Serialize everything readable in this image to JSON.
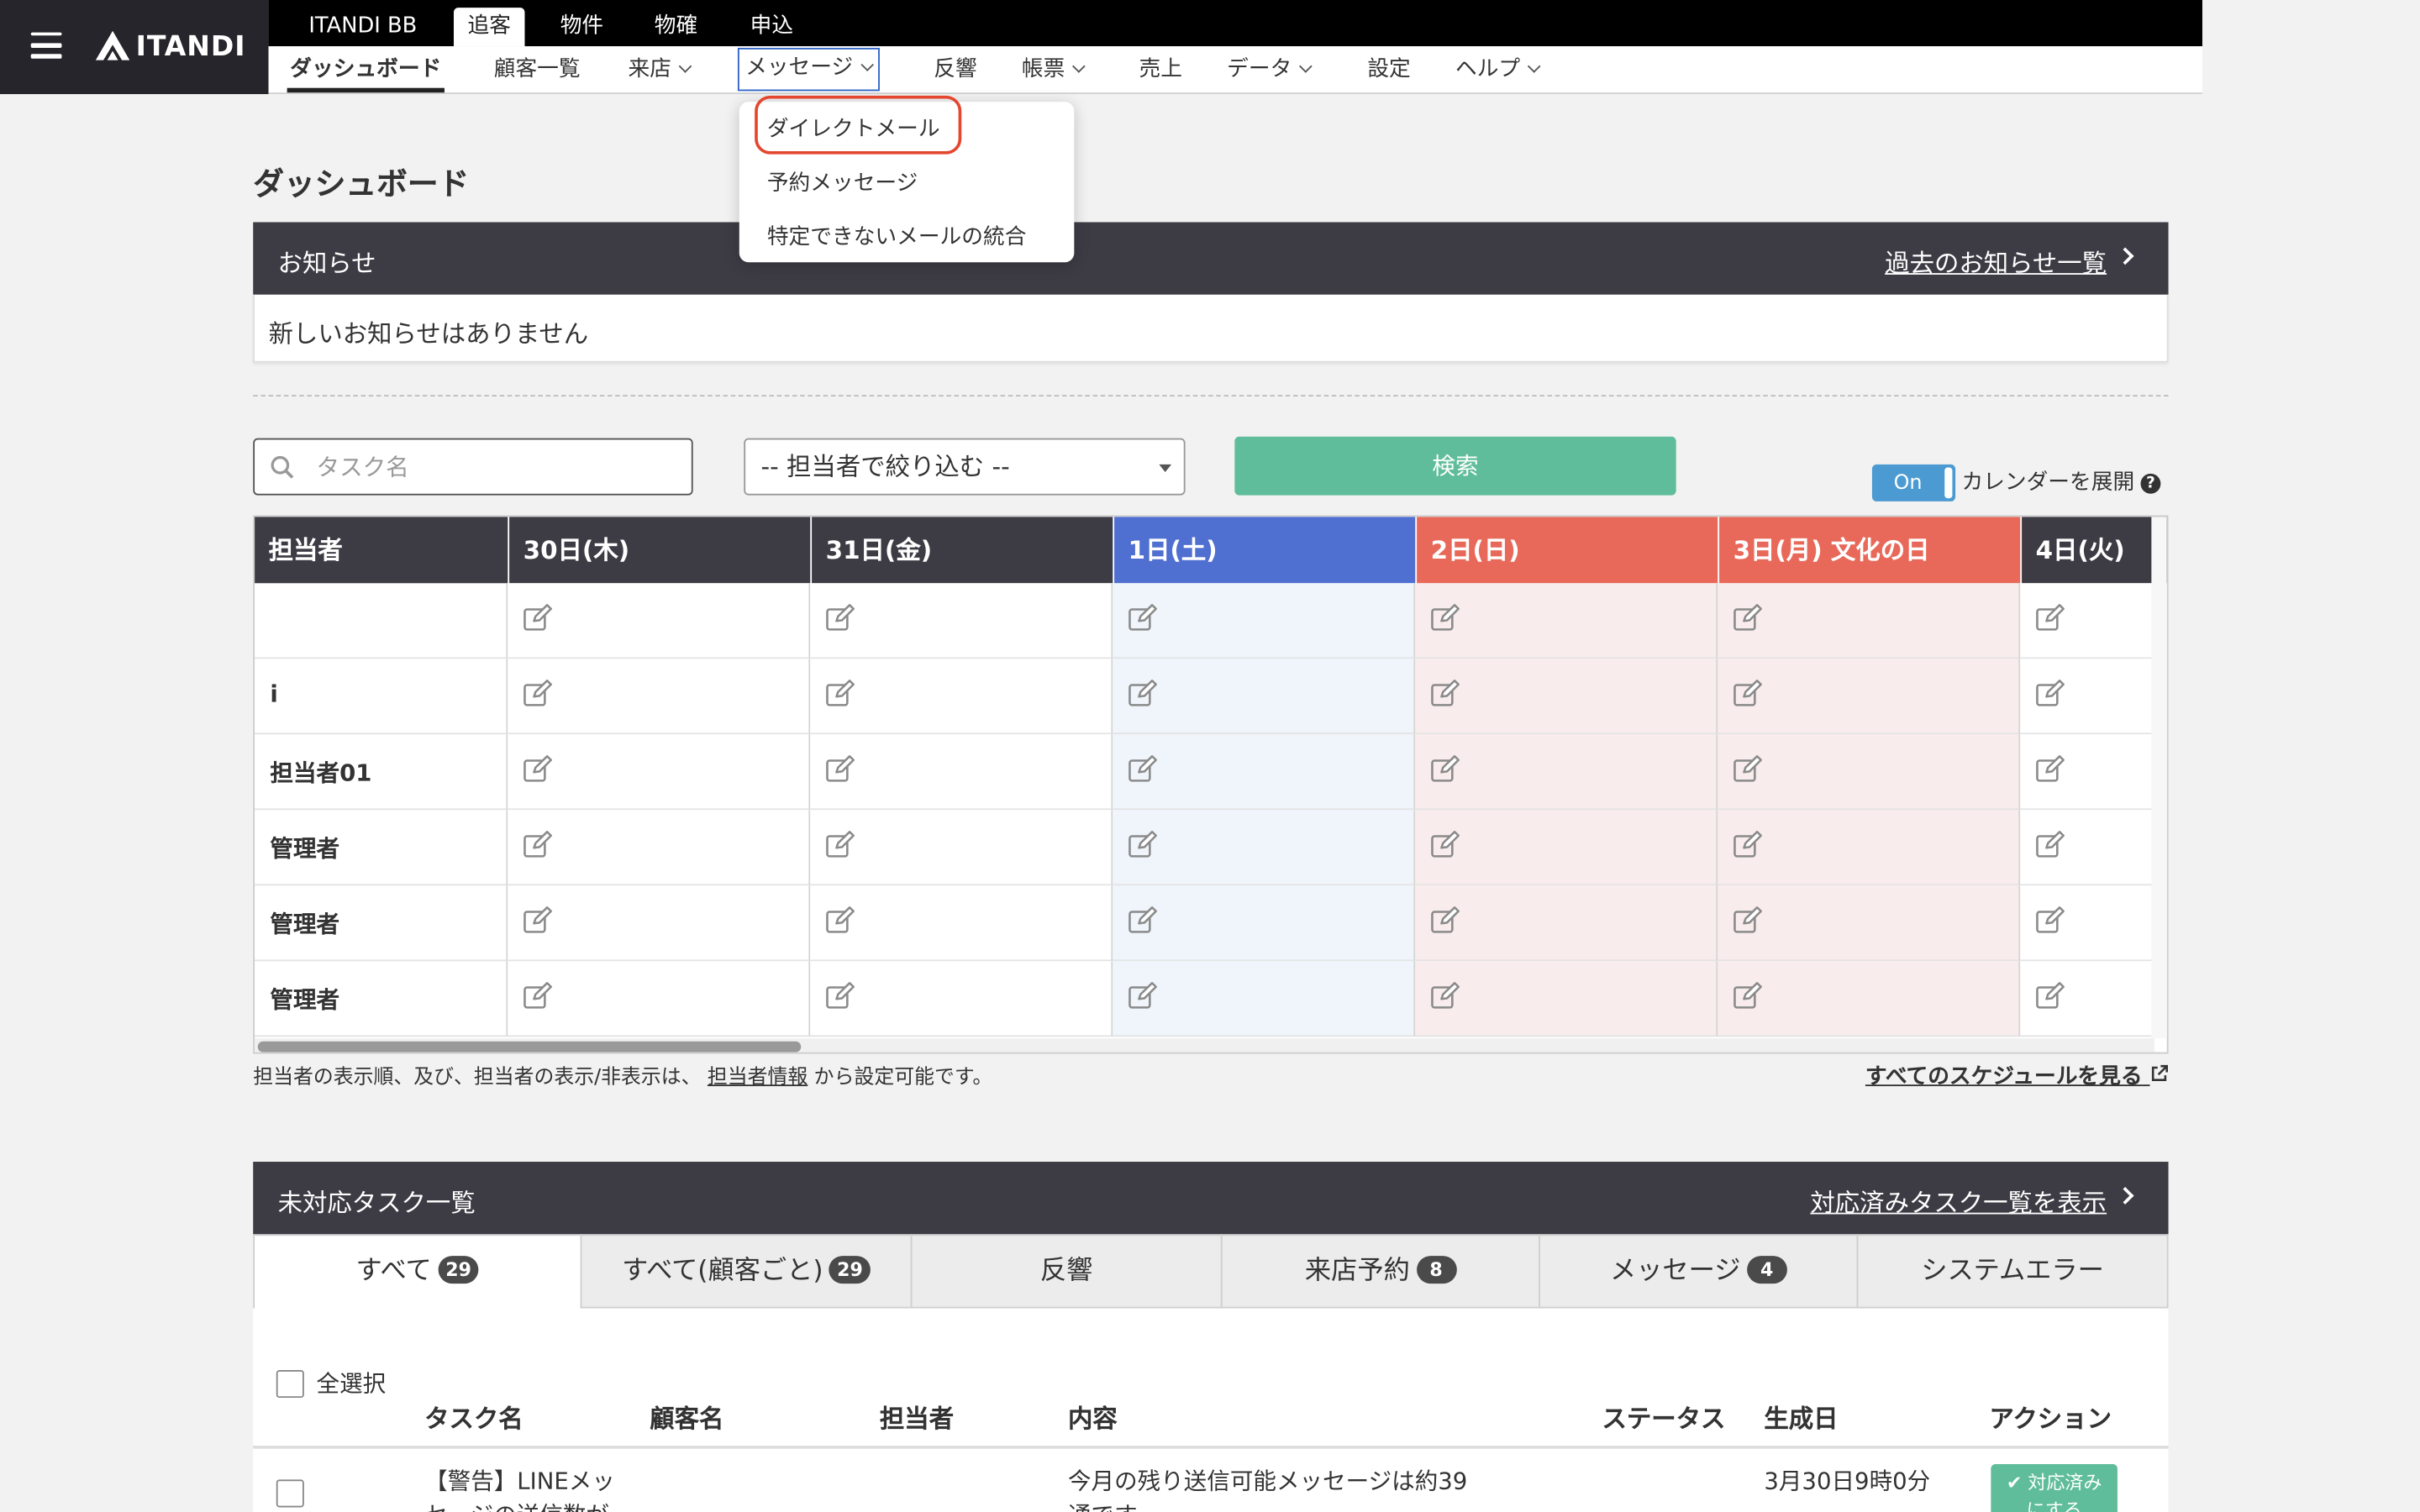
{
  "header": {
    "logo_text": "ITANDI",
    "top_tabs": [
      "ITANDI BB",
      "追客",
      "物件",
      "物確",
      "申込"
    ],
    "nav": [
      "ダッシュボード",
      "顧客一覧",
      "来店",
      "メッセージ",
      "反響",
      "帳票",
      "売上",
      "データ",
      "設定",
      "ヘルプ"
    ]
  },
  "dropdown": {
    "items": [
      "ダイレクトメール",
      "予約メッセージ",
      "特定できないメールの統合"
    ]
  },
  "page": {
    "title": "ダッシュボード"
  },
  "notice": {
    "title": "お知らせ",
    "link": "過去のお知らせ一覧",
    "body": "新しいお知らせはありません"
  },
  "filters": {
    "search_placeholder": "タスク名",
    "assignee_select": "-- 担当者で絞り込む --",
    "search_button": "検索",
    "toggle_label": "On",
    "calendar_label": "カレンダーを展開",
    "help_glyph": "?"
  },
  "calendar": {
    "header_first": "担当者",
    "days": [
      {
        "label": "30日(木)",
        "kind": "normal"
      },
      {
        "label": "31日(金)",
        "kind": "normal"
      },
      {
        "label": "1日(土)",
        "kind": "saturday"
      },
      {
        "label": "2日(日)",
        "kind": "holiday"
      },
      {
        "label": "3日(月) 文化の日",
        "kind": "holiday"
      },
      {
        "label": "4日(火)",
        "kind": "normal"
      }
    ],
    "rows": [
      "",
      "i",
      "担当者01",
      "管理者",
      "管理者",
      "管理者"
    ],
    "note_prefix": "担当者の表示順、及び、担当者の表示/非表示は、",
    "note_link": "担当者情報",
    "note_suffix": "から設定可能です。",
    "all_schedule_link": "すべてのスケジュールを見る",
    "colors": {
      "normal_head": "#3d3b44",
      "saturday_head": "#4f6fd1",
      "holiday_head": "#e8695a",
      "saturday_cell": "#eff5fb",
      "holiday_cell": "#f9ecec"
    }
  },
  "tasks": {
    "title": "未対応タスク一覧",
    "link": "対応済みタスク一覧を表示",
    "tabs": [
      {
        "label": "すべて",
        "count": "29"
      },
      {
        "label": "すべて(顧客ごと)",
        "count": "29"
      },
      {
        "label": "反響",
        "count": ""
      },
      {
        "label": "来店予約",
        "count": "8"
      },
      {
        "label": "メッセージ",
        "count": "4"
      },
      {
        "label": "システムエラー",
        "count": ""
      }
    ],
    "select_all": "全選択",
    "columns": [
      "タスク名",
      "顧客名",
      "担当者",
      "内容",
      "ステータス",
      "生成日",
      "アクション"
    ],
    "row1": {
      "task_name_l1": "【警告】LINEメッ",
      "task_name_l2": "セージの送信数が",
      "content_l1": "今月の残り送信可能メッセージは約39",
      "content_l2": "通です",
      "created": "3月30日9時0分",
      "action_l1": "✔ 対応済み",
      "action_l2": "にする"
    }
  }
}
